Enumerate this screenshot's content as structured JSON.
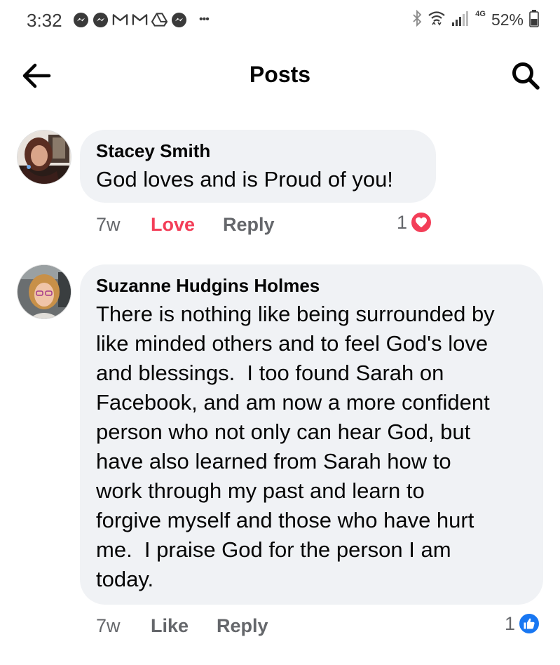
{
  "status_bar": {
    "time": "3:32",
    "left_icons": [
      "messenger-icon",
      "messenger-icon",
      "gmail-icon",
      "gmail-icon",
      "drive-icon",
      "messenger-icon"
    ],
    "more_dots": "•••",
    "network": "4G",
    "battery": "52%"
  },
  "header": {
    "title": "Posts"
  },
  "comments": [
    {
      "author": "Stacey Smith",
      "text": "God loves and is Proud of you!",
      "time": "7w",
      "reaction_label": "Love",
      "reply_label": "Reply",
      "reaction_count": "1",
      "reaction_type": "love",
      "reaction_color": "#f33e58"
    },
    {
      "author": "Suzanne Hudgins Holmes",
      "text": "There is nothing like being surrounded by\nlike minded others and to feel God's love\nand blessings.  I too found Sarah on\nFacebook, and am now a more confident\nperson who not only can hear God, but\nhave also learned from Sarah how to\nwork through my past and learn to\nforgive myself and those who have hurt\nme.  I praise God for the person I am\ntoday.",
      "time": "7w",
      "reaction_label": "Like",
      "reply_label": "Reply",
      "reaction_count": "1",
      "reaction_type": "like",
      "reaction_color": "#1877f2"
    }
  ]
}
